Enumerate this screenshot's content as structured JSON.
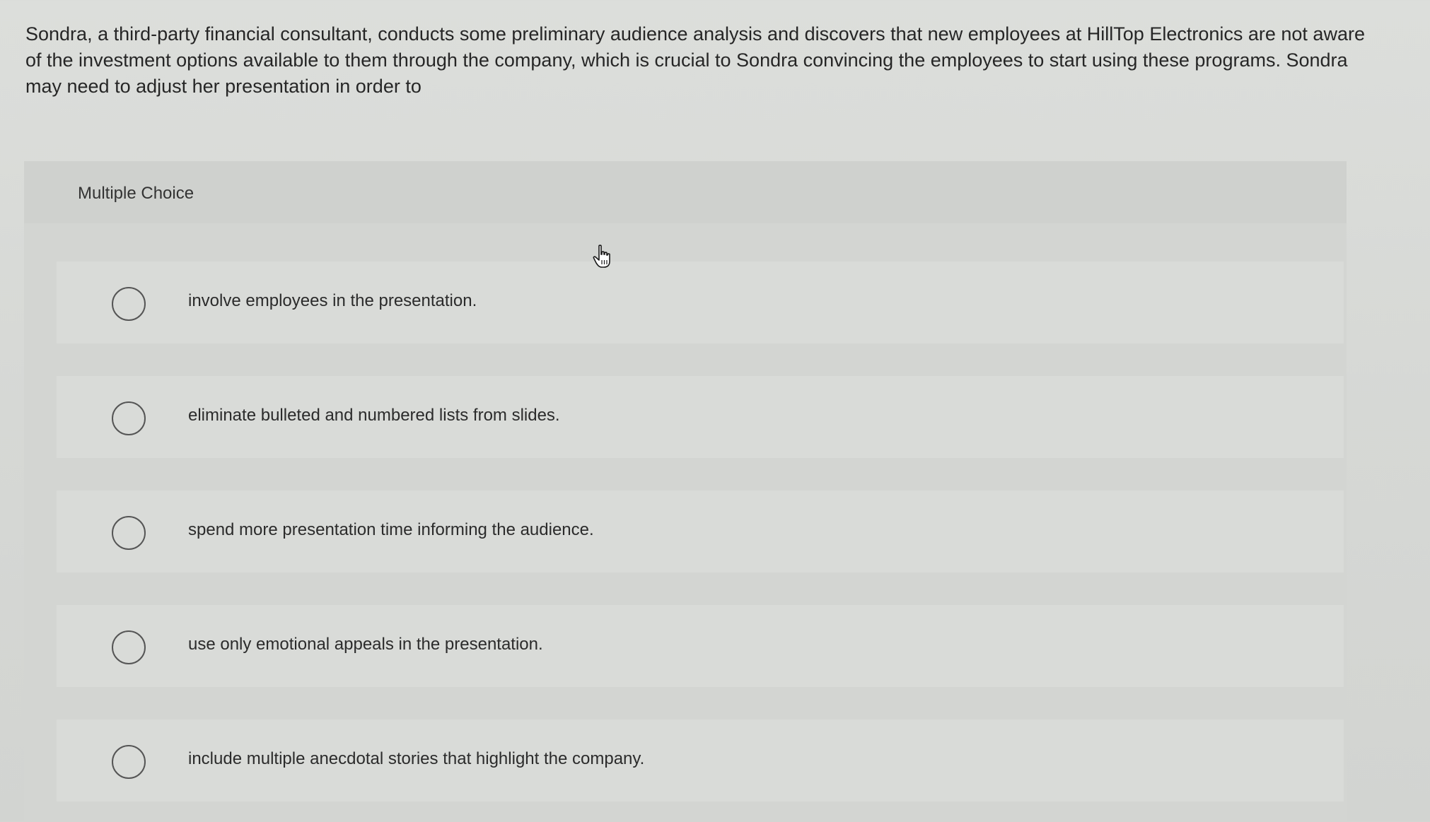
{
  "question": {
    "text": "Sondra, a third-party financial consultant, conducts some preliminary audience analysis and discovers that new employees at HillTop Electronics are not aware of the investment options available to them through the company, which is crucial to Sondra convincing the employees to start using these programs. Sondra may need to adjust her presentation in order to"
  },
  "panel": {
    "title": "Multiple Choice"
  },
  "options": [
    {
      "label": "involve employees in the presentation.",
      "selected": false
    },
    {
      "label": "eliminate bulleted and numbered lists from slides.",
      "selected": false
    },
    {
      "label": "spend more presentation time informing the audience.",
      "selected": false
    },
    {
      "label": "use only emotional appeals in the presentation.",
      "selected": false
    },
    {
      "label": "include multiple anecdotal stories that highlight the company.",
      "selected": false
    }
  ],
  "cursor": {
    "icon": "hand-pointer-icon"
  }
}
